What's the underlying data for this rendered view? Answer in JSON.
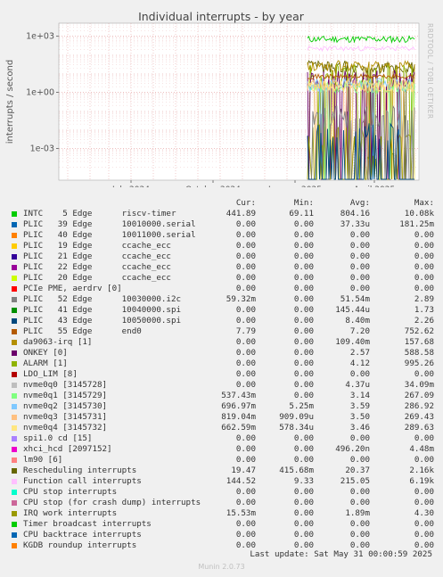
{
  "chart_data": {
    "type": "line",
    "title": "Individual interrupts - by year",
    "ylabel": "interrupts / second",
    "yscale": "log",
    "ylim": [
      2e-05,
      5000
    ],
    "y_ticks": [
      "1e+03",
      "1e+00",
      "1e-03"
    ],
    "x_ticks": [
      "July 2024",
      "October 2024",
      "January 2025",
      "April 2025"
    ],
    "grid": true,
    "columns": [
      "Cur:",
      "Min:",
      "Avg:",
      "Max:"
    ],
    "series": [
      {
        "name": "INTC    5 Edge      riscv-timer",
        "color": "#00cc00",
        "values": [
          "441.89",
          "69.11",
          "804.16",
          "10.08k"
        ]
      },
      {
        "name": "PLIC   39 Edge      10010000.serial",
        "color": "#0066b3",
        "values": [
          "0.00",
          "0.00",
          "37.33u",
          "181.25m"
        ]
      },
      {
        "name": "PLIC   40 Edge      10011000.serial",
        "color": "#ff8000",
        "values": [
          "0.00",
          "0.00",
          "0.00",
          "0.00"
        ]
      },
      {
        "name": "PLIC   19 Edge      ccache_ecc",
        "color": "#ffcc00",
        "values": [
          "0.00",
          "0.00",
          "0.00",
          "0.00"
        ]
      },
      {
        "name": "PLIC   21 Edge      ccache_ecc",
        "color": "#330099",
        "values": [
          "0.00",
          "0.00",
          "0.00",
          "0.00"
        ]
      },
      {
        "name": "PLIC   22 Edge      ccache_ecc",
        "color": "#990099",
        "values": [
          "0.00",
          "0.00",
          "0.00",
          "0.00"
        ]
      },
      {
        "name": "PLIC   20 Edge      ccache_ecc",
        "color": "#ccff00",
        "values": [
          "0.00",
          "0.00",
          "0.00",
          "0.00"
        ]
      },
      {
        "name": "PCIe PME, aerdrv [0]",
        "color": "#ff0000",
        "values": [
          "0.00",
          "0.00",
          "0.00",
          "0.00"
        ]
      },
      {
        "name": "PLIC   52 Edge      10030000.i2c",
        "color": "#808080",
        "values": [
          "59.32m",
          "0.00",
          "51.54m",
          "2.89"
        ]
      },
      {
        "name": "PLIC   41 Edge      10040000.spi",
        "color": "#008f00",
        "values": [
          "0.00",
          "0.00",
          "145.44u",
          "1.73"
        ]
      },
      {
        "name": "PLIC   43 Edge      10050000.spi",
        "color": "#00487d",
        "values": [
          "0.00",
          "0.00",
          "8.40m",
          "2.26"
        ]
      },
      {
        "name": "PLIC   55 Edge      end0",
        "color": "#b35a00",
        "values": [
          "7.79",
          "0.00",
          "7.20",
          "752.62"
        ]
      },
      {
        "name": "da9063-irq [1]",
        "color": "#b38f00",
        "values": [
          "0.00",
          "0.00",
          "109.40m",
          "157.68"
        ]
      },
      {
        "name": "ONKEY [0]",
        "color": "#6b006b",
        "values": [
          "0.00",
          "0.00",
          "2.57",
          "588.58"
        ]
      },
      {
        "name": "ALARM [1]",
        "color": "#8fb300",
        "values": [
          "0.00",
          "0.00",
          "4.12",
          "995.26"
        ]
      },
      {
        "name": "LDO_LIM [8]",
        "color": "#b30000",
        "values": [
          "0.00",
          "0.00",
          "0.00",
          "0.00"
        ]
      },
      {
        "name": "nvme0q0 [3145728]",
        "color": "#bebebe",
        "values": [
          "0.00",
          "0.00",
          "4.37u",
          "34.09m"
        ]
      },
      {
        "name": "nvme0q1 [3145729]",
        "color": "#80ff80",
        "values": [
          "537.43m",
          "0.00",
          "3.14",
          "267.09"
        ]
      },
      {
        "name": "nvme0q2 [3145730]",
        "color": "#80c9ff",
        "values": [
          "696.97m",
          "5.25m",
          "3.59",
          "286.92"
        ]
      },
      {
        "name": "nvme0q3 [3145731]",
        "color": "#ffc080",
        "values": [
          "819.04m",
          "909.09u",
          "3.50",
          "269.43"
        ]
      },
      {
        "name": "nvme0q4 [3145732]",
        "color": "#ffe680",
        "values": [
          "662.59m",
          "578.34u",
          "3.46",
          "289.63"
        ]
      },
      {
        "name": "spi1.0 cd [15]",
        "color": "#aa80ff",
        "values": [
          "0.00",
          "0.00",
          "0.00",
          "0.00"
        ]
      },
      {
        "name": "xhci_hcd [2097152]",
        "color": "#ee00cc",
        "values": [
          "0.00",
          "0.00",
          "496.20n",
          "4.48m"
        ]
      },
      {
        "name": "lm90 [6]",
        "color": "#ff8080",
        "values": [
          "0.00",
          "0.00",
          "0.00",
          "0.00"
        ]
      },
      {
        "name": "Rescheduling interrupts",
        "color": "#666600",
        "values": [
          "19.47",
          "415.68m",
          "20.37",
          "2.16k"
        ]
      },
      {
        "name": "Function call interrupts",
        "color": "#ffbfff",
        "values": [
          "144.52",
          "9.33",
          "215.05",
          "6.19k"
        ]
      },
      {
        "name": "CPU stop interrupts",
        "color": "#00ffcc",
        "values": [
          "0.00",
          "0.00",
          "0.00",
          "0.00"
        ]
      },
      {
        "name": "CPU stop (for crash dump) interrupts",
        "color": "#cc6699",
        "values": [
          "0.00",
          "0.00",
          "0.00",
          "0.00"
        ]
      },
      {
        "name": "IRQ work interrupts",
        "color": "#999900",
        "values": [
          "15.53m",
          "0.00",
          "1.89m",
          "4.30"
        ]
      },
      {
        "name": "Timer broadcast interrupts",
        "color": "#00cc00",
        "values": [
          "0.00",
          "0.00",
          "0.00",
          "0.00"
        ]
      },
      {
        "name": "CPU backtrace interrupts",
        "color": "#0066b3",
        "values": [
          "0.00",
          "0.00",
          "0.00",
          "0.00"
        ]
      },
      {
        "name": "KGDB roundup interrupts",
        "color": "#ff8000",
        "values": [
          "0.00",
          "0.00",
          "0.00",
          "0.00"
        ]
      }
    ]
  },
  "side_label": "RRDTOOL / TOBI OETIKER",
  "footer": "Last update: Sat May 31 00:00:59 2025",
  "munin_version": "Munin 2.0.73"
}
